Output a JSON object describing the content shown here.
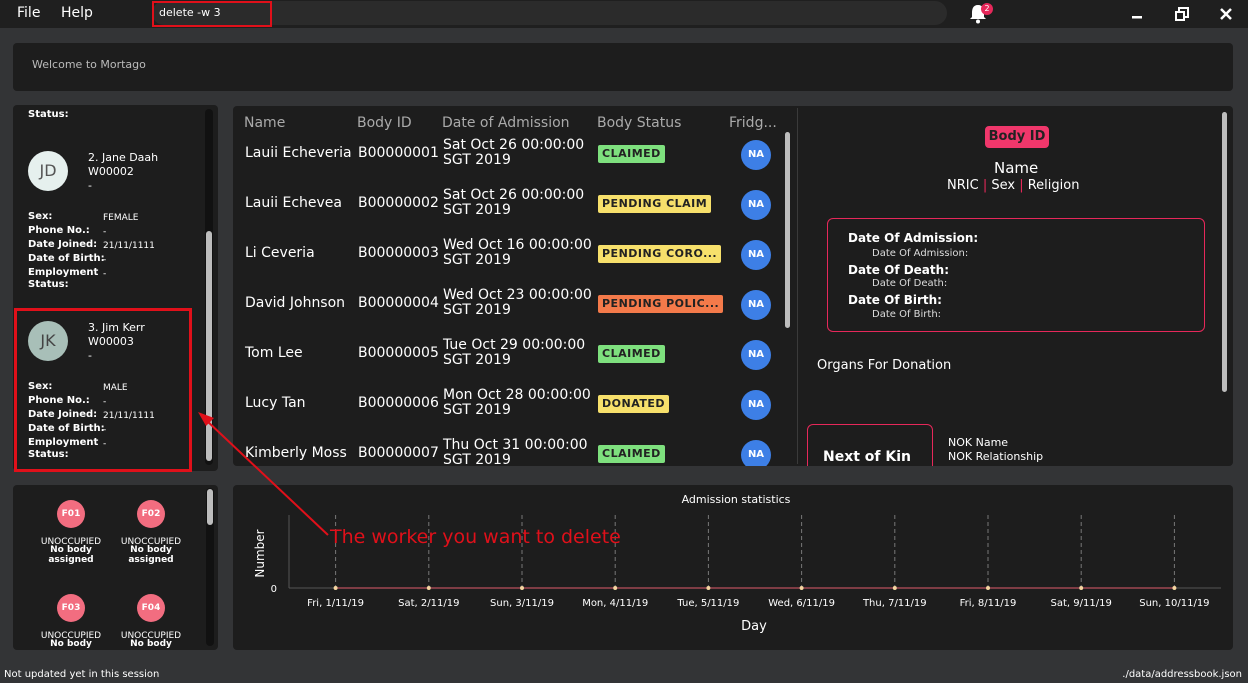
{
  "menu": {
    "file": "File",
    "help": "Help"
  },
  "command": {
    "value": "delete -w 3"
  },
  "notifications": {
    "count": "2"
  },
  "welcome": "Welcome to Mortago",
  "workers": {
    "top_status_label": "Status:",
    "items": [
      {
        "initials": "JD",
        "title": "2. Jane Daah",
        "id": "W00002",
        "dash": "-",
        "avatar_color": "#e6f0ee",
        "sex_label": "Sex:",
        "sex": "FEMALE",
        "phone_label": "Phone No.:",
        "phone": "-",
        "joined_label": "Date Joined:",
        "joined": "21/11/1111",
        "dob_label": "Date of Birth:",
        "dob": "-",
        "emp_label": "Employment",
        "emp": "-",
        "status_label": "Status:"
      },
      {
        "initials": "JK",
        "title": "3. Jim Kerr",
        "id": "W00003",
        "dash": "-",
        "avatar_color": "#a8bfb8",
        "sex_label": "Sex:",
        "sex": "MALE",
        "phone_label": "Phone No.:",
        "phone": "-",
        "joined_label": "Date Joined:",
        "joined": "21/11/1111",
        "dob_label": "Date of Birth:",
        "dob": "-",
        "emp_label": "Employment",
        "emp": "-",
        "status_label": "Status:"
      }
    ]
  },
  "fridges": [
    {
      "id": "F01",
      "status": "UNOCCUPIED",
      "note": "No body assigned"
    },
    {
      "id": "F02",
      "status": "UNOCCUPIED",
      "note": "No body assigned"
    },
    {
      "id": "F03",
      "status": "UNOCCUPIED",
      "note": "No body"
    },
    {
      "id": "F04",
      "status": "UNOCCUPIED",
      "note": "No body"
    }
  ],
  "table": {
    "headers": [
      "Name",
      "Body ID",
      "Date of Admission",
      "Body Status",
      "Fridg..."
    ],
    "rows": [
      {
        "name": "Lauii Echeveria",
        "id": "B00000001",
        "date1": "Sat Oct 26 00:00:00",
        "date2": "SGT 2019",
        "status": "CLAIMED",
        "color": "#7ee07e",
        "fridge": "NA"
      },
      {
        "name": "Lauii Echevea",
        "id": "B00000002",
        "date1": "Sat Oct 26 00:00:00",
        "date2": "SGT 2019",
        "status": "PENDING CLAIM",
        "color": "#f7e06b",
        "fridge": "NA"
      },
      {
        "name": "Li Ceveria",
        "id": "B00000003",
        "date1": "Wed Oct 16 00:00:00",
        "date2": "SGT 2019",
        "status": "PENDING CORO...",
        "color": "#f7e06b",
        "fridge": "NA"
      },
      {
        "name": "David Johnson",
        "id": "B00000004",
        "date1": "Wed Oct 23 00:00:00",
        "date2": "SGT 2019",
        "status": "PENDING POLIC...",
        "color": "#f47a4a",
        "fridge": "NA"
      },
      {
        "name": "Tom Lee",
        "id": "B00000005",
        "date1": "Tue Oct 29 00:00:00",
        "date2": "SGT 2019",
        "status": "CLAIMED",
        "color": "#7ee07e",
        "fridge": "NA"
      },
      {
        "name": "Lucy Tan",
        "id": "B00000006",
        "date1": "Mon Oct 28 00:00:00",
        "date2": "SGT 2019",
        "status": "DONATED",
        "color": "#f7e06b",
        "fridge": "NA"
      },
      {
        "name": "Kimberly Moss",
        "id": "B00000007",
        "date1": "Thu Oct 31 00:00:00",
        "date2": "SGT 2019",
        "status": "CLAIMED",
        "color": "#7ee07e",
        "fridge": "NA"
      }
    ]
  },
  "details": {
    "tag": "Body ID",
    "name": "Name",
    "nric": "NRIC",
    "sex": "Sex",
    "religion": "Religion",
    "sep": "|",
    "doa_label": "Date Of Admission:",
    "doa_value": "Date Of Admission:",
    "dod_label": "Date Of Death:",
    "dod_value": "Date Of Death:",
    "dob_label": "Date Of Birth:",
    "dob_value": "Date Of Birth:",
    "organs": "Organs For Donation",
    "nok_title": "Next of Kin",
    "nok_name": "NOK Name",
    "nok_rel": "NOK Relationship"
  },
  "chart_data": {
    "type": "line",
    "title": "Admission statistics",
    "xlabel": "Day",
    "ylabel": "Number",
    "categories": [
      "Fri, 1/11/19",
      "Sat, 2/11/19",
      "Sun, 3/11/19",
      "Mon, 4/11/19",
      "Tue, 5/11/19",
      "Wed, 6/11/19",
      "Thu, 7/11/19",
      "Fri, 8/11/19",
      "Sat, 9/11/19",
      "Sun, 10/11/19"
    ],
    "values": [
      0,
      0,
      0,
      0,
      0,
      0,
      0,
      0,
      0,
      0
    ],
    "y_ticks": [
      "0"
    ],
    "grid": "vertical dashed",
    "line_color": "#e05a6a"
  },
  "annotation": "The worker you want to delete",
  "footer": {
    "left": "Not updated yet in this session",
    "right": "./data/addressbook.json"
  }
}
